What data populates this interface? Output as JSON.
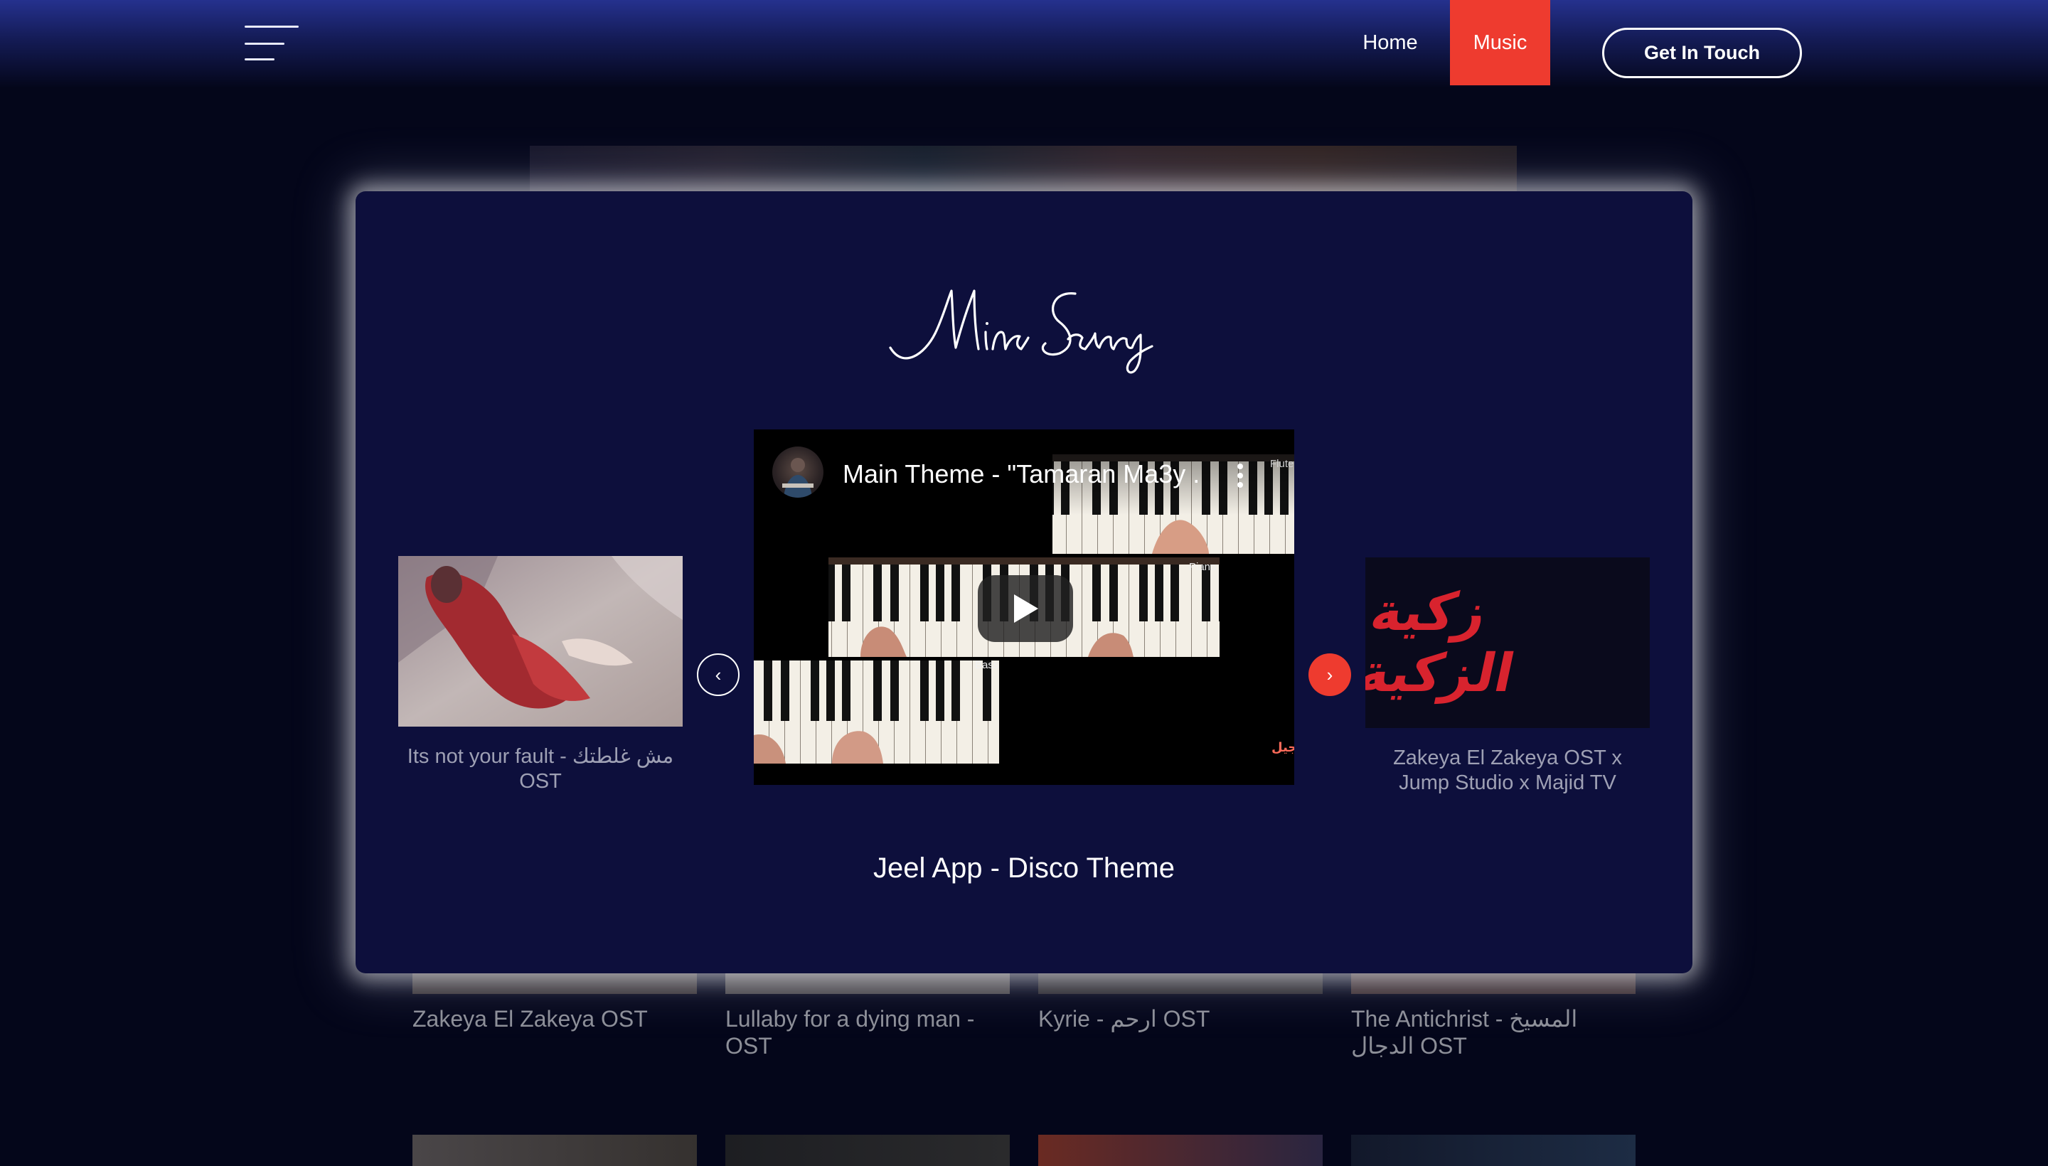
{
  "header": {
    "menu_icon": "hamburger-menu-icon",
    "nav": [
      {
        "label": "Home",
        "active": false
      },
      {
        "label": "Music",
        "active": true
      }
    ],
    "cta_label": "Get In Touch",
    "accent_color": "#ee3b2f"
  },
  "background_grid": {
    "titles": [
      "Zakeya El Zakeya OST",
      "Lullaby for a dying man - OST",
      "Kyrie - ارحم OST",
      "The Antichrist - المسيخ الدجال OST"
    ]
  },
  "modal": {
    "signature": "Mina Samy",
    "prev_item": {
      "title": "Its not your fault - مش غلطتك OST"
    },
    "next_item": {
      "title": "Zakeya El Zakeya OST x Jump Studio x Majid TV",
      "thumb_text": "زكية الزكية"
    },
    "video": {
      "title": "Main Theme - \"Tamaran Ma3y ...",
      "labels": {
        "flute": "Flute",
        "piano": "Piano",
        "bass": "Bass"
      },
      "watermark": "جيل"
    },
    "current_title": "Jeel App - Disco Theme",
    "prev_arrow": "‹",
    "next_arrow": "›"
  }
}
